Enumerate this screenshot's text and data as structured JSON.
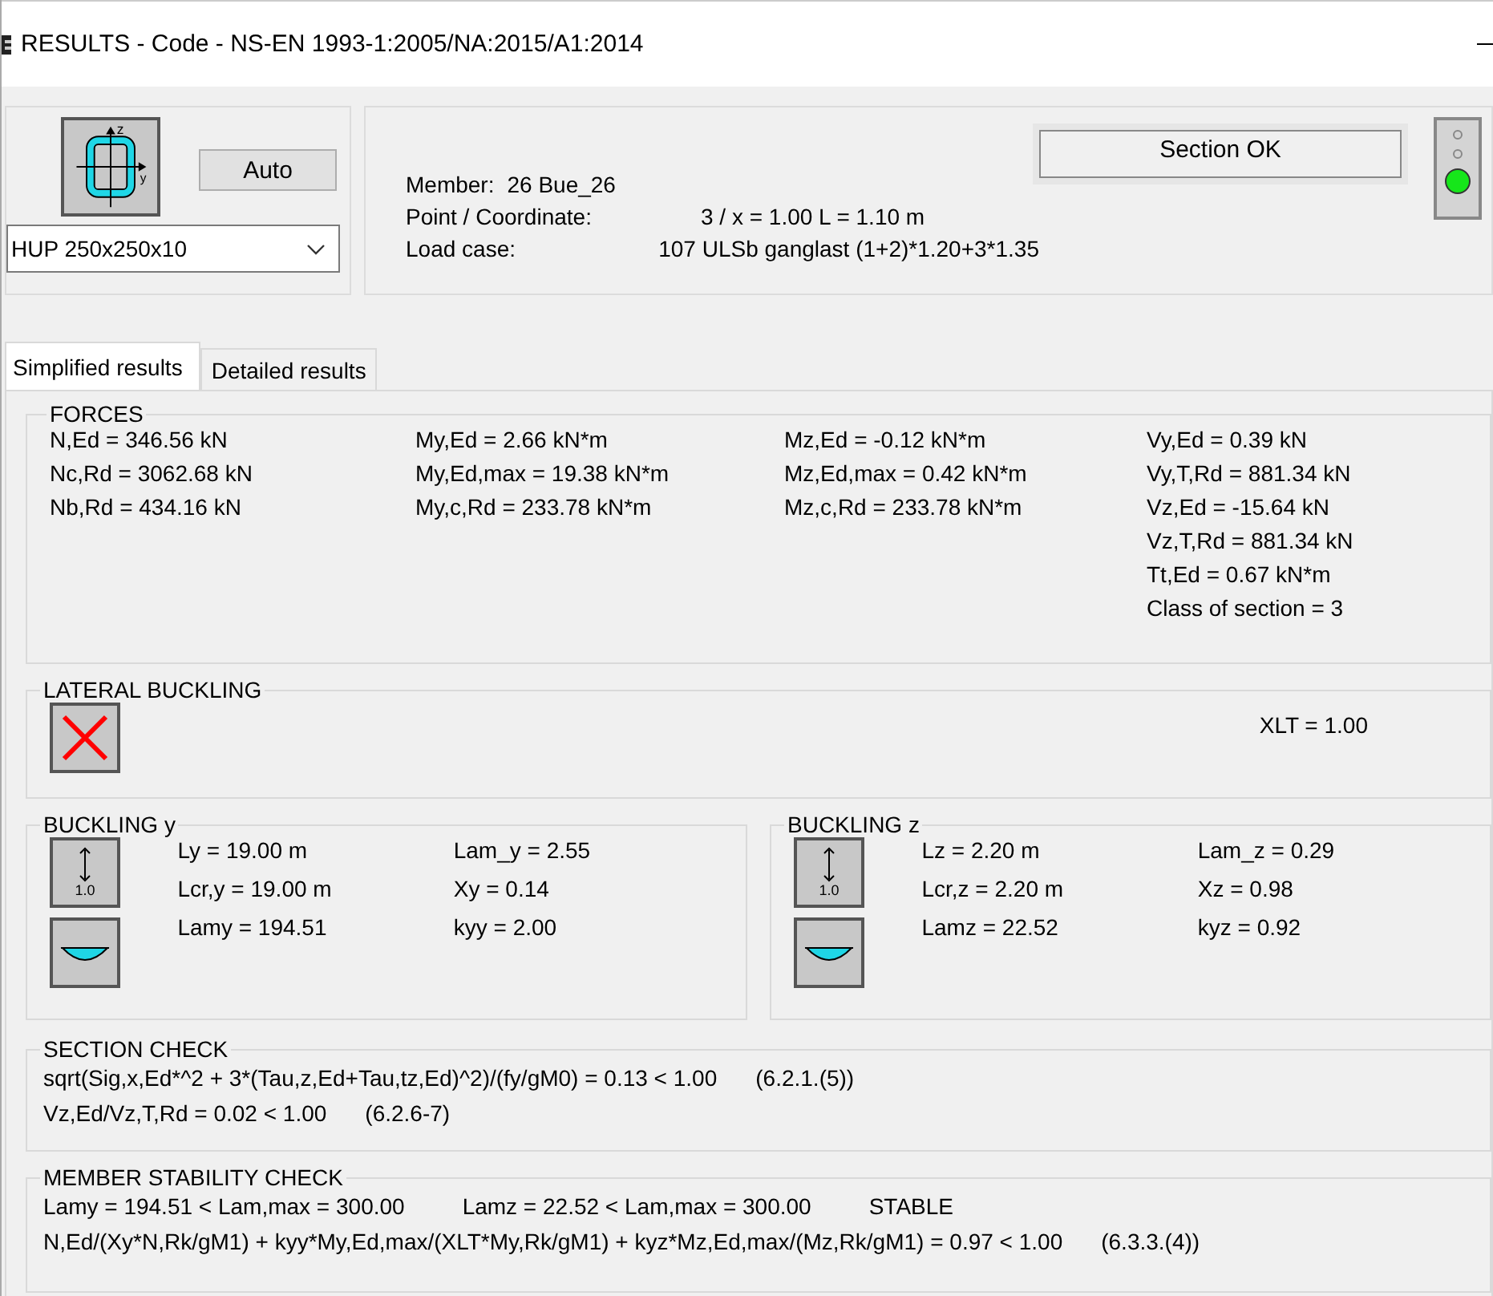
{
  "window": {
    "title": "RESULTS - Code - NS-EN 1993-1:2005/NA:2015/A1:2014"
  },
  "section": {
    "axis_labels": [
      "z",
      "y"
    ],
    "auto_button": "Auto",
    "profile": "HUP 250x250x10"
  },
  "info": {
    "member_label": "Member:",
    "member_value": "26  Bue_26",
    "rows": [
      {
        "label": "Point / Coordinate:",
        "value": "3 / x = 1.00 L = 1.10 m"
      },
      {
        "label": "Load case:",
        "value": "107 ULSb ganglast  (1+2)*1.20+3*1.35"
      }
    ],
    "status": "Section OK",
    "status_ok": true
  },
  "tabs": [
    {
      "label": "Simplified results",
      "selected": true
    },
    {
      "label": "Detailed results",
      "selected": false
    }
  ],
  "forces": {
    "title": "FORCES",
    "columns": [
      [
        "N,Ed = 346.56 kN",
        "Nc,Rd = 3062.68 kN",
        "Nb,Rd = 434.16 kN"
      ],
      [
        "My,Ed = 2.66 kN*m",
        "My,Ed,max = 19.38 kN*m",
        "My,c,Rd = 233.78 kN*m"
      ],
      [
        "Mz,Ed = -0.12 kN*m",
        "Mz,Ed,max = 0.42 kN*m",
        "Mz,c,Rd = 233.78 kN*m"
      ],
      [
        "Vy,Ed = 0.39 kN",
        "Vy,T,Rd = 881.34 kN",
        "Vz,Ed = -15.64 kN",
        "Vz,T,Rd = 881.34 kN",
        "Tt,Ed = 0.67 kN*m",
        "Class of section = 3"
      ]
    ]
  },
  "lateral_buckling": {
    "title": "LATERAL BUCKLING",
    "checked": false,
    "value": "XLT = 1.00"
  },
  "buckling": [
    {
      "title": "BUCKLING y",
      "factor_label": "1.0",
      "columns": [
        [
          "Ly = 19.00 m",
          "Lcr,y = 19.00 m",
          "Lamy = 194.51"
        ],
        [
          "Lam_y = 2.55",
          "Xy = 0.14",
          "kyy = 2.00"
        ]
      ]
    },
    {
      "title": "BUCKLING z",
      "factor_label": "1.0",
      "columns": [
        [
          "Lz = 2.20 m",
          "Lcr,z = 2.20 m",
          "Lamz = 22.52"
        ],
        [
          "Lam_z = 0.29",
          "Xz = 0.98",
          "kyz = 0.92"
        ]
      ]
    }
  ],
  "section_check": {
    "title": "SECTION CHECK",
    "lines": [
      [
        "sqrt(Sig,x,Ed*^2 + 3*(Tau,z,Ed+Tau,tz,Ed)^2)/(fy/gM0) = 0.13 < 1.00",
        "(6.2.1.(5))"
      ],
      [
        "Vz,Ed/Vz,T,Rd = 0.02 < 1.00",
        "(6.2.6-7)"
      ]
    ]
  },
  "stability_check": {
    "title": "MEMBER STABILITY CHECK",
    "lines": [
      [
        "Lamy = 194.51 < Lam,max = 300.00",
        "Lamz = 22.52 < Lam,max = 300.00",
        "STABLE"
      ],
      [
        "N,Ed/(Xy*N,Rk/gM1) + kyy*My,Ed,max/(XLT*My,Rk/gM1) + kyz*Mz,Ed,max/(Mz,Rk/gM1) = 0.97 < 1.00",
        "(6.3.3.(4))"
      ]
    ]
  }
}
